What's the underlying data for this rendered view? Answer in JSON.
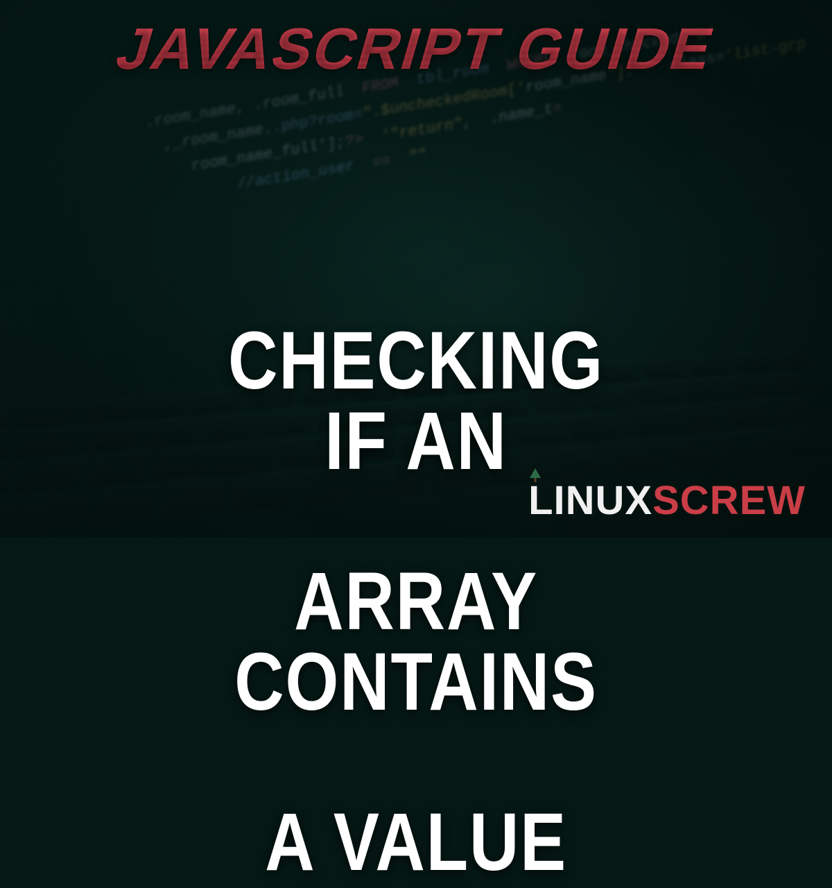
{
  "title": "JAVASCRIPT GUIDE",
  "subtitle_line1": "CHECKING IF AN",
  "subtitle_line2": "ARRAY CONTAINS",
  "subtitle_line3": "A VALUE",
  "logo": {
    "l": "L",
    "inux": "INUX",
    "screw": "SCREW"
  },
  "bg_code": "  .room_name, .room_full  FROM  tbl_room  WHERE  room_checked='0'\n    ,_room_name..php?room=\".$uncheckedRoom['room_name'].\"'  class='list-grp\n       room_name_full'];?>  '\"return\",  .name_t=\n            //action_user  ==  \"\""
}
